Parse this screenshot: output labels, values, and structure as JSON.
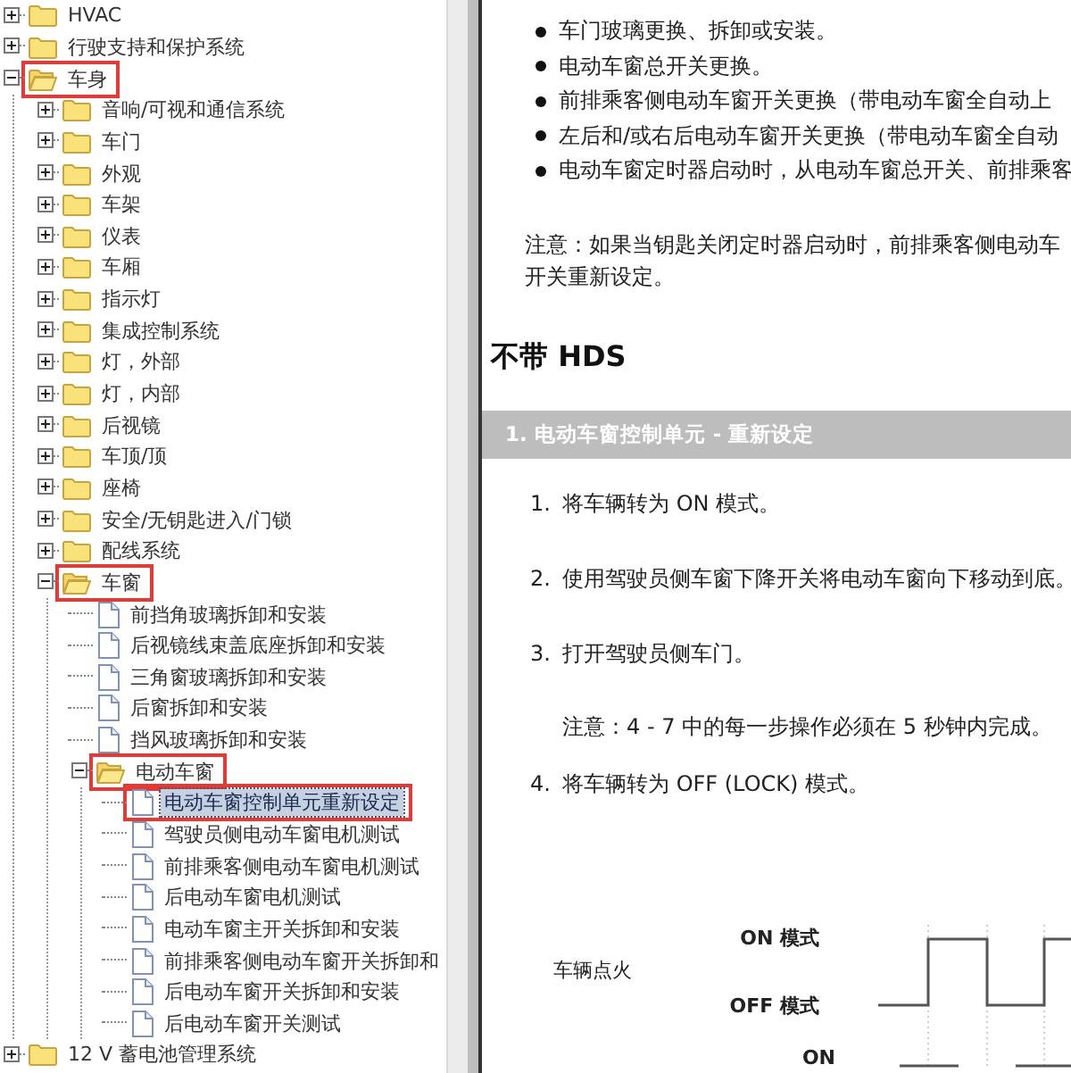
{
  "tree": [
    {
      "label": "HVAC",
      "kind": "folder",
      "expanded": false,
      "selected": false,
      "highlighted": false
    },
    {
      "label": "行驶支持和保护系统",
      "kind": "folder",
      "expanded": false,
      "selected": false,
      "highlighted": false
    },
    {
      "label": "车身",
      "kind": "folder",
      "expanded": true,
      "selected": false,
      "highlighted": true,
      "children": [
        {
          "label": "音响/可视和通信系统",
          "kind": "folder",
          "expanded": false,
          "selected": false,
          "highlighted": false
        },
        {
          "label": "车门",
          "kind": "folder",
          "expanded": false,
          "selected": false,
          "highlighted": false
        },
        {
          "label": "外观",
          "kind": "folder",
          "expanded": false,
          "selected": false,
          "highlighted": false
        },
        {
          "label": "车架",
          "kind": "folder",
          "expanded": false,
          "selected": false,
          "highlighted": false
        },
        {
          "label": "仪表",
          "kind": "folder",
          "expanded": false,
          "selected": false,
          "highlighted": false
        },
        {
          "label": "车厢",
          "kind": "folder",
          "expanded": false,
          "selected": false,
          "highlighted": false
        },
        {
          "label": "指示灯",
          "kind": "folder",
          "expanded": false,
          "selected": false,
          "highlighted": false
        },
        {
          "label": "集成控制系统",
          "kind": "folder",
          "expanded": false,
          "selected": false,
          "highlighted": false
        },
        {
          "label": "灯，外部",
          "kind": "folder",
          "expanded": false,
          "selected": false,
          "highlighted": false
        },
        {
          "label": "灯，内部",
          "kind": "folder",
          "expanded": false,
          "selected": false,
          "highlighted": false
        },
        {
          "label": "后视镜",
          "kind": "folder",
          "expanded": false,
          "selected": false,
          "highlighted": false
        },
        {
          "label": "车顶/顶",
          "kind": "folder",
          "expanded": false,
          "selected": false,
          "highlighted": false
        },
        {
          "label": "座椅",
          "kind": "folder",
          "expanded": false,
          "selected": false,
          "highlighted": false
        },
        {
          "label": "安全/无钥匙进入/门锁",
          "kind": "folder",
          "expanded": false,
          "selected": false,
          "highlighted": false
        },
        {
          "label": "配线系统",
          "kind": "folder",
          "expanded": false,
          "selected": false,
          "highlighted": false
        },
        {
          "label": "车窗",
          "kind": "folder",
          "expanded": true,
          "selected": false,
          "highlighted": true,
          "children": [
            {
              "label": "前挡角玻璃拆卸和安装",
              "kind": "page",
              "selected": false,
              "highlighted": false
            },
            {
              "label": "后视镜线束盖底座拆卸和安装",
              "kind": "page",
              "selected": false,
              "highlighted": false
            },
            {
              "label": "三角窗玻璃拆卸和安装",
              "kind": "page",
              "selected": false,
              "highlighted": false
            },
            {
              "label": "后窗拆卸和安装",
              "kind": "page",
              "selected": false,
              "highlighted": false
            },
            {
              "label": "挡风玻璃拆卸和安装",
              "kind": "page",
              "selected": false,
              "highlighted": false
            },
            {
              "label": "电动车窗",
              "kind": "folder",
              "expanded": true,
              "selected": false,
              "highlighted": true,
              "children": [
                {
                  "label": "电动车窗控制单元重新设定",
                  "kind": "page",
                  "selected": true,
                  "highlighted": true
                },
                {
                  "label": "驾驶员侧电动车窗电机测试",
                  "kind": "page",
                  "selected": false,
                  "highlighted": false
                },
                {
                  "label": "前排乘客侧电动车窗电机测试",
                  "kind": "page",
                  "selected": false,
                  "highlighted": false
                },
                {
                  "label": "后电动车窗电机测试",
                  "kind": "page",
                  "selected": false,
                  "highlighted": false
                },
                {
                  "label": "电动车窗主开关拆卸和安装",
                  "kind": "page",
                  "selected": false,
                  "highlighted": false
                },
                {
                  "label": "前排乘客侧电动车窗开关拆卸和",
                  "kind": "page",
                  "selected": false,
                  "highlighted": false
                },
                {
                  "label": "后电动车窗开关拆卸和安装",
                  "kind": "page",
                  "selected": false,
                  "highlighted": false
                },
                {
                  "label": "后电动车窗开关测试",
                  "kind": "page",
                  "selected": false,
                  "highlighted": false
                }
              ]
            }
          ]
        }
      ]
    },
    {
      "label": "12 V 蓄电池管理系统",
      "kind": "folder",
      "expanded": false,
      "selected": false,
      "highlighted": false
    }
  ],
  "document": {
    "bullets": [
      "车门玻璃更换、拆卸或安装。",
      "电动车窗总开关更换。",
      "前排乘客侧电动车窗开关更换（带电动车窗全自动上",
      "左后和/或右后电动车窗开关更换（带电动车窗全自动",
      "电动车窗定时器启动时，从电动车窗总开关、前排乘客"
    ],
    "note_lines": [
      "注意：如果当钥匙关闭定时器启动时，前排乘客侧电动车",
      "开关重新设定。"
    ],
    "heading": "不带 HDS",
    "section_title": "1. 电动车窗控制单元 - 重新设定",
    "steps": [
      {
        "number": "1.",
        "text": "将车辆转为 ON 模式。"
      },
      {
        "number": "2.",
        "text": "使用驾驶员侧车窗下降开关将电动车窗向下移动到底。"
      },
      {
        "number": "3.",
        "text": "打开驾驶员侧车门。",
        "note": "注意：4 - 7 中的每一步操作必须在 5 秒钟内完成。"
      },
      {
        "number": "4.",
        "text": "将车辆转为 OFF (LOCK) 模式。"
      }
    ],
    "diagram": {
      "signal_label": "车辆点火",
      "high_label": "ON 模式",
      "low_label": "OFF 模式",
      "next_label": "ON"
    }
  }
}
